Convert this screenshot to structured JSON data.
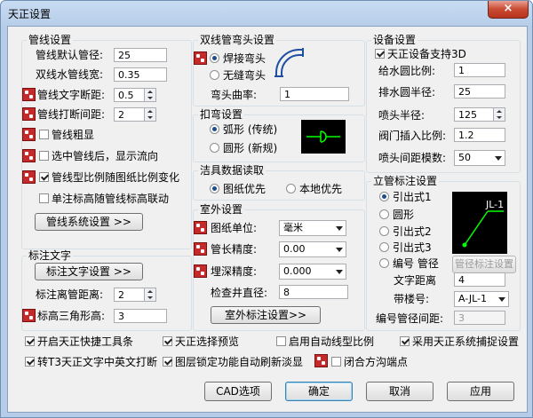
{
  "window": {
    "title": "天正设置",
    "close": "×"
  },
  "pipe": {
    "title": "管线设置",
    "default_dn": {
      "label": "管线默认管径:",
      "value": "25"
    },
    "double_width": {
      "label": "双线水管线宽:",
      "value": "0.35"
    },
    "text_break": {
      "label": "管线文字断距:",
      "value": "0.5"
    },
    "break_gap": {
      "label": "管线打断间距:",
      "value": "2"
    },
    "thick": {
      "label": "管线粗显"
    },
    "show_flow": {
      "label": "选中管线后，显示流向"
    },
    "scale_change": {
      "label": "管线型比例随图纸比例变化"
    },
    "single_link": {
      "label": "单注标高随管线标高联动"
    },
    "sys_button": "管线系统设置 >>"
  },
  "text": {
    "title": "标注文字",
    "setting_button": "标注文字设置 >>",
    "pipe_distance": {
      "label": "标注离管距离:",
      "value": "2"
    },
    "triangle_height": {
      "label": "标高三角形高:",
      "value": "3"
    }
  },
  "elbow": {
    "title": "双线管弯头设置",
    "welded": "焊接弯头",
    "seamless": "无缝弯头",
    "curvature": {
      "label": "弯头曲率:",
      "value": "1"
    }
  },
  "bend": {
    "title": "扣弯设置",
    "arc": "弧形 (传统)",
    "circle": "圆形 (新规)"
  },
  "clean": {
    "title": "洁具数据读取",
    "drawing": "图纸优先",
    "local": "本地优先"
  },
  "outdoor": {
    "title": "室外设置",
    "unit": {
      "label": "图纸单位:",
      "value": "毫米"
    },
    "length_prec": {
      "label": "管长精度:",
      "value": "0.00"
    },
    "depth_prec": {
      "label": "埋深精度:",
      "value": "0.000"
    },
    "well_dia": {
      "label": "检查井直径:",
      "value": "8"
    },
    "button": "室外标注设置>>"
  },
  "equip": {
    "title": "设备设置",
    "support3d": "天正设备支持3D",
    "feed_ratio": {
      "label": "给水圆比例:",
      "value": "1"
    },
    "drain_radius": {
      "label": "排水圆半径:",
      "value": "25"
    },
    "nozzle_radius": {
      "label": "喷头半径:",
      "value": "125"
    },
    "valve_ratio": {
      "label": "阀门插入比例:",
      "value": "1.2"
    },
    "nozzle_modulus": {
      "label": "喷头间距模数:",
      "value": "50"
    }
  },
  "riser": {
    "title": "立管标注设置",
    "opt1": "引出式1",
    "opt_circle": "圆形",
    "opt2": "引出式2",
    "opt3": "引出式3",
    "opt_num": "编号 管径",
    "dia_button": "管径标注设置",
    "text_dist": {
      "label": "文字距离",
      "value": "4"
    },
    "prefix": {
      "label": "带楼号:",
      "value": "A-JL-1"
    },
    "num_dist": {
      "label": "编号管径间距:",
      "value": "3"
    },
    "preview_text": "JL-1"
  },
  "options": {
    "toolbar": "开启天正快捷工具条",
    "preview": "天正选择预览",
    "auto_scale": "启用自动线型比例",
    "snap": "采用天正系统捕捉设置",
    "t3_break": "转T3天正文字中英文打断",
    "layer_lock": "图层锁定功能自动刷新淡显",
    "closed_ditch": "闭合方沟端点"
  },
  "buttons": {
    "cad": "CAD选项",
    "ok": "确定",
    "cancel": "取消",
    "apply": "应用"
  },
  "colors": {
    "pin": "#c52a2a",
    "preview_bg": "#000000",
    "preview_line": "#00ff00",
    "preview_text": "#ffffff"
  }
}
